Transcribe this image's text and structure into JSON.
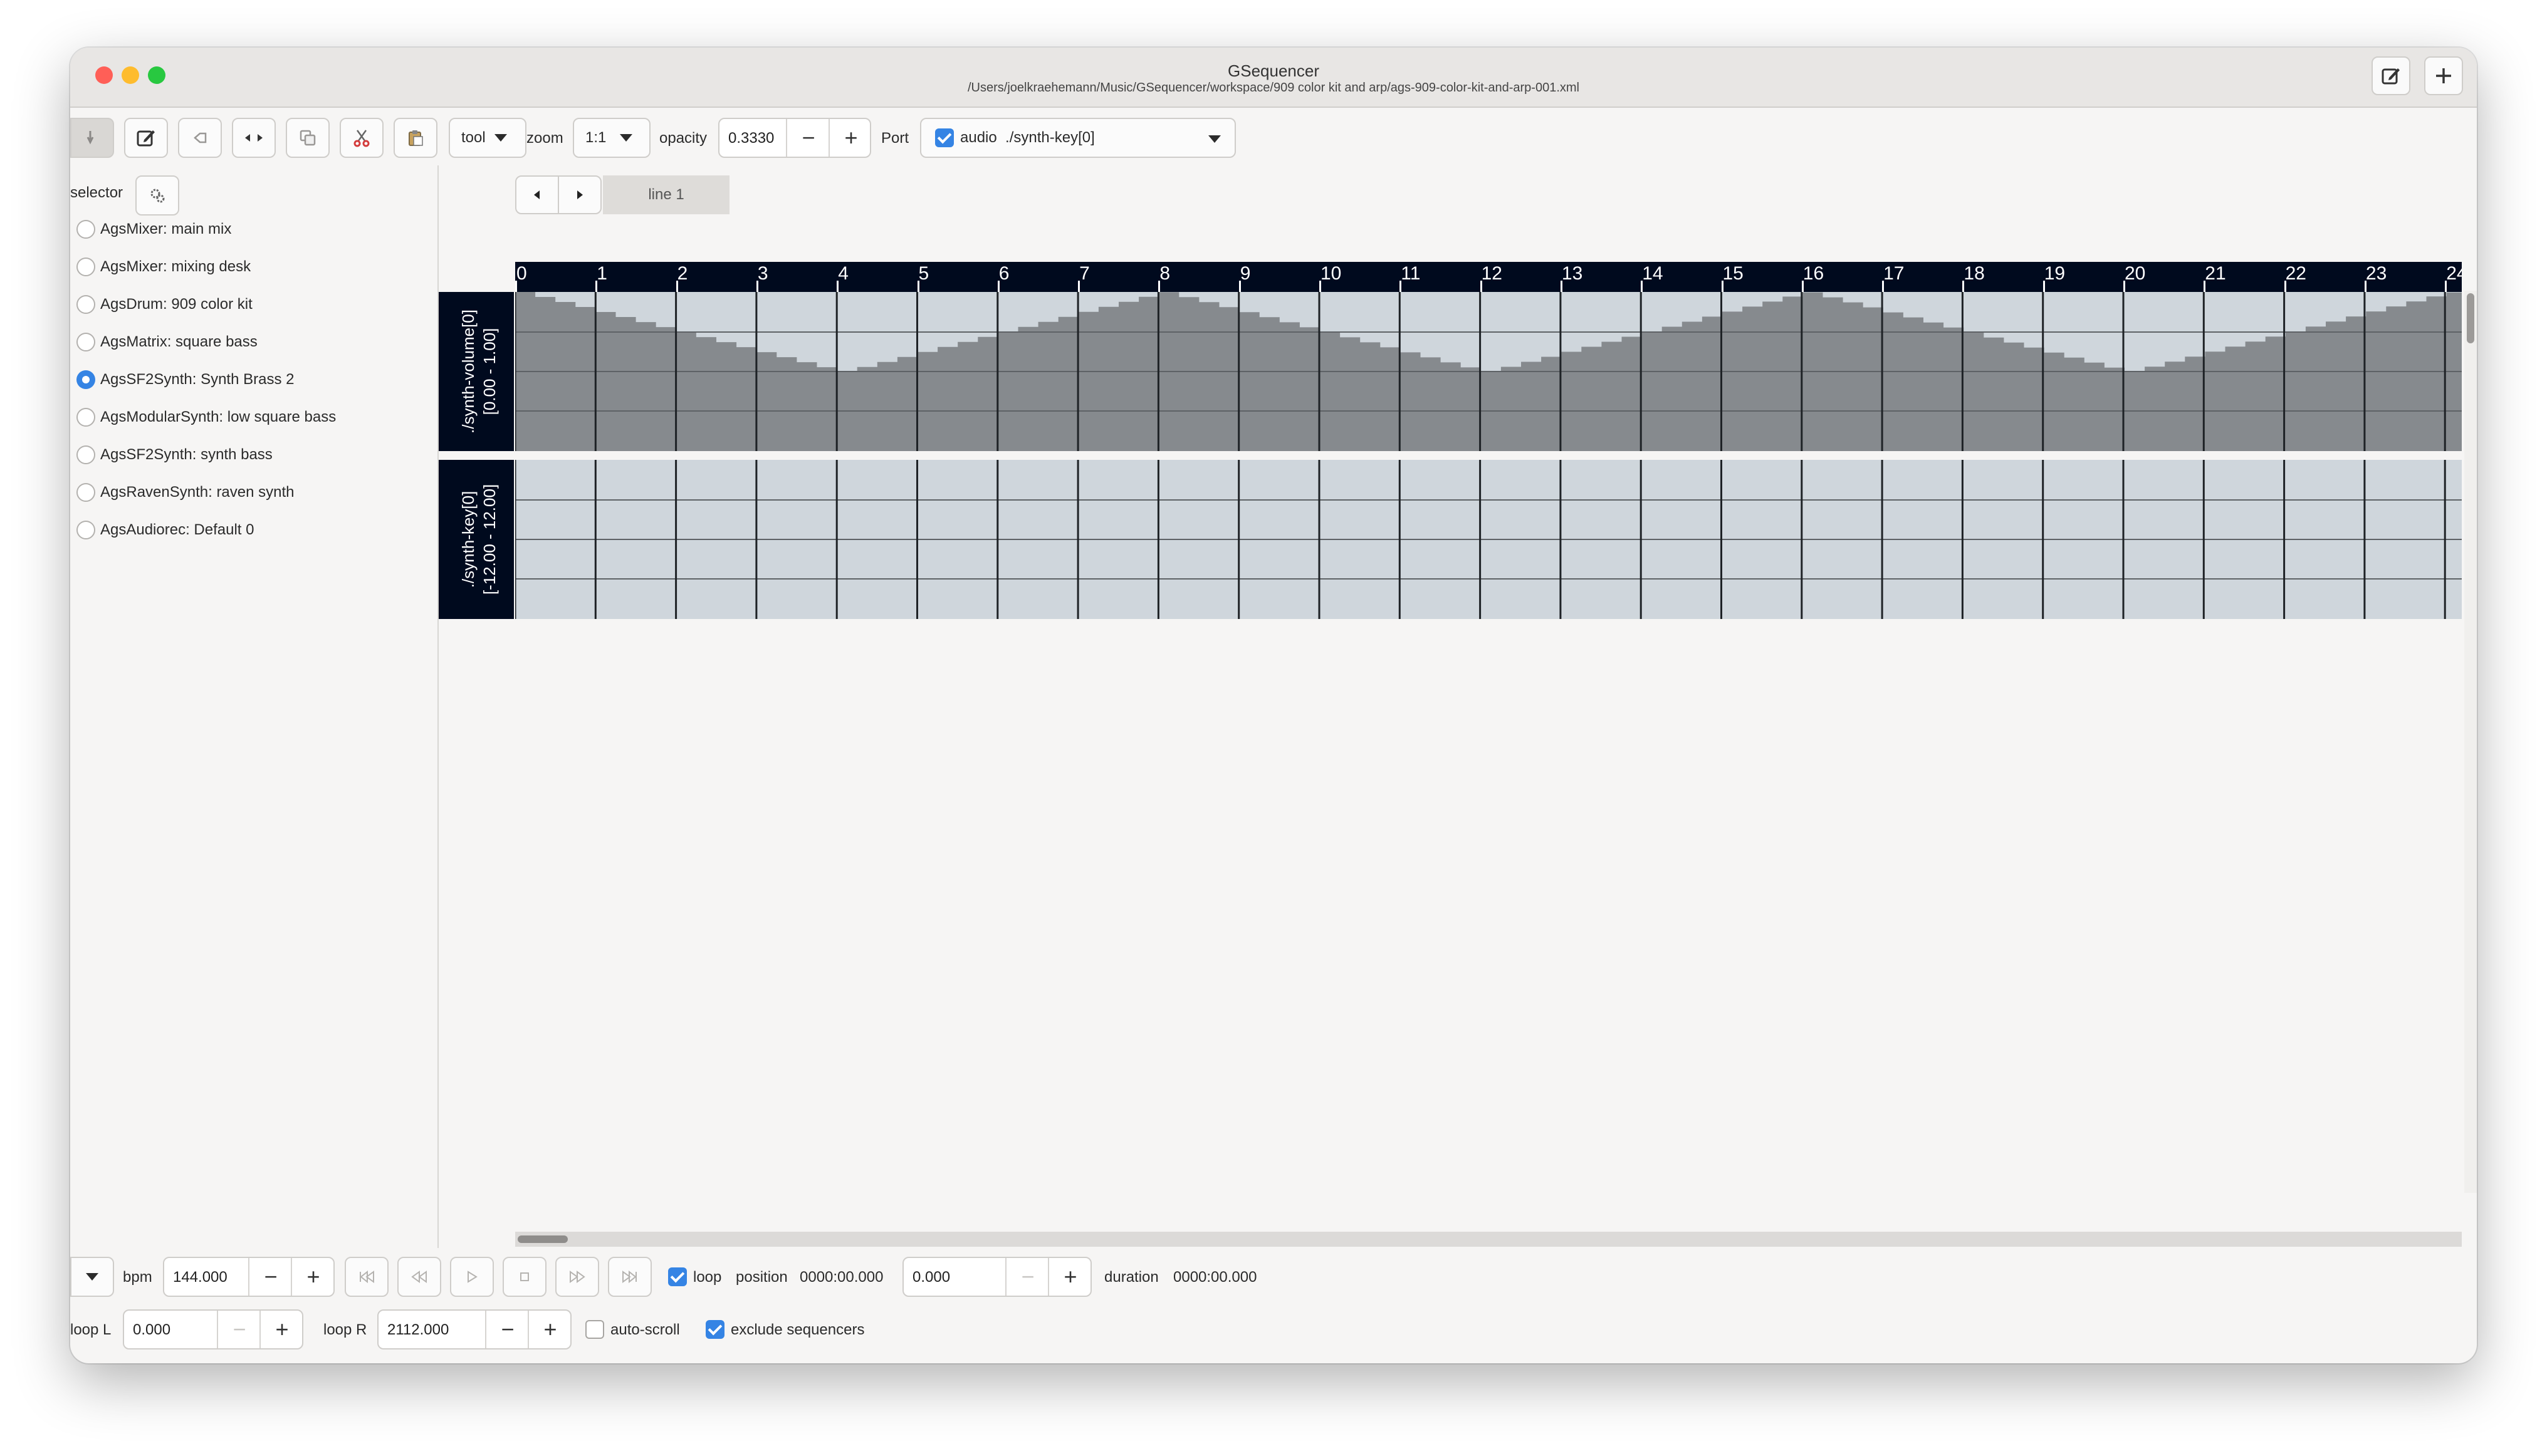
{
  "window": {
    "title": "GSequencer",
    "path": "/Users/joelkraehemann/Music/GSequencer/workspace/909 color kit and arp/ags-909-color-kit-and-arp-001.xml"
  },
  "header_buttons": [
    "edit-document-icon",
    "plus-icon"
  ],
  "toolbar": {
    "tool_label": "tool",
    "zoom_label": "zoom",
    "zoom_value": "1:1",
    "opacity_label": "opacity",
    "opacity_value": "0.3330",
    "port_label": "Port",
    "port_value": "audio  ./synth-key[0]",
    "port_checked": true
  },
  "sidebar": {
    "selector_label": "selector",
    "machines": [
      {
        "label": "AgsMixer: main mix",
        "selected": false
      },
      {
        "label": "AgsMixer: mixing desk",
        "selected": false
      },
      {
        "label": "AgsDrum: 909 color kit",
        "selected": false
      },
      {
        "label": "AgsMatrix: square bass",
        "selected": false
      },
      {
        "label": "AgsSF2Synth: Synth Brass 2",
        "selected": true
      },
      {
        "label": "AgsModularSynth: low square bass",
        "selected": false
      },
      {
        "label": "AgsSF2Synth: synth bass",
        "selected": false
      },
      {
        "label": "AgsRavenSynth: raven synth",
        "selected": false
      },
      {
        "label": "AgsAudiorec: Default 0",
        "selected": false
      }
    ]
  },
  "editor": {
    "tab_label": "line 1",
    "ruler_ticks": [
      "0",
      "1",
      "2",
      "3",
      "4",
      "5",
      "6",
      "7",
      "8",
      "9",
      "10",
      "11",
      "12",
      "13",
      "14",
      "15",
      "16",
      "17",
      "18",
      "19",
      "20",
      "21",
      "22",
      "23",
      "24"
    ],
    "lanes": [
      {
        "name": "./synth-volume[0]",
        "range": "[0.00 - 1.00]"
      },
      {
        "name": "./synth-key[0]",
        "range": "[-12.00 - 12.00]"
      }
    ]
  },
  "transport": {
    "bpm_label": "bpm",
    "bpm_value": "144.000",
    "loop_label": "loop",
    "loop_checked": true,
    "position_label": "position",
    "position_time": "0000:00.000",
    "position_value": "0.000",
    "duration_label": "duration",
    "duration_value": "0000:00.000",
    "loop_l_label": "loop L",
    "loop_l_value": "0.000",
    "loop_r_label": "loop R",
    "loop_r_value": "2112.000",
    "auto_scroll_label": "auto-scroll",
    "auto_scroll_checked": false,
    "exclude_label": "exclude sequencers",
    "exclude_checked": true
  },
  "colors": {
    "accent": "#3584e4",
    "ruler_bg": "#000a1e",
    "lane_bg": "#cfd6dc",
    "automation_fill": "#868a8e"
  }
}
